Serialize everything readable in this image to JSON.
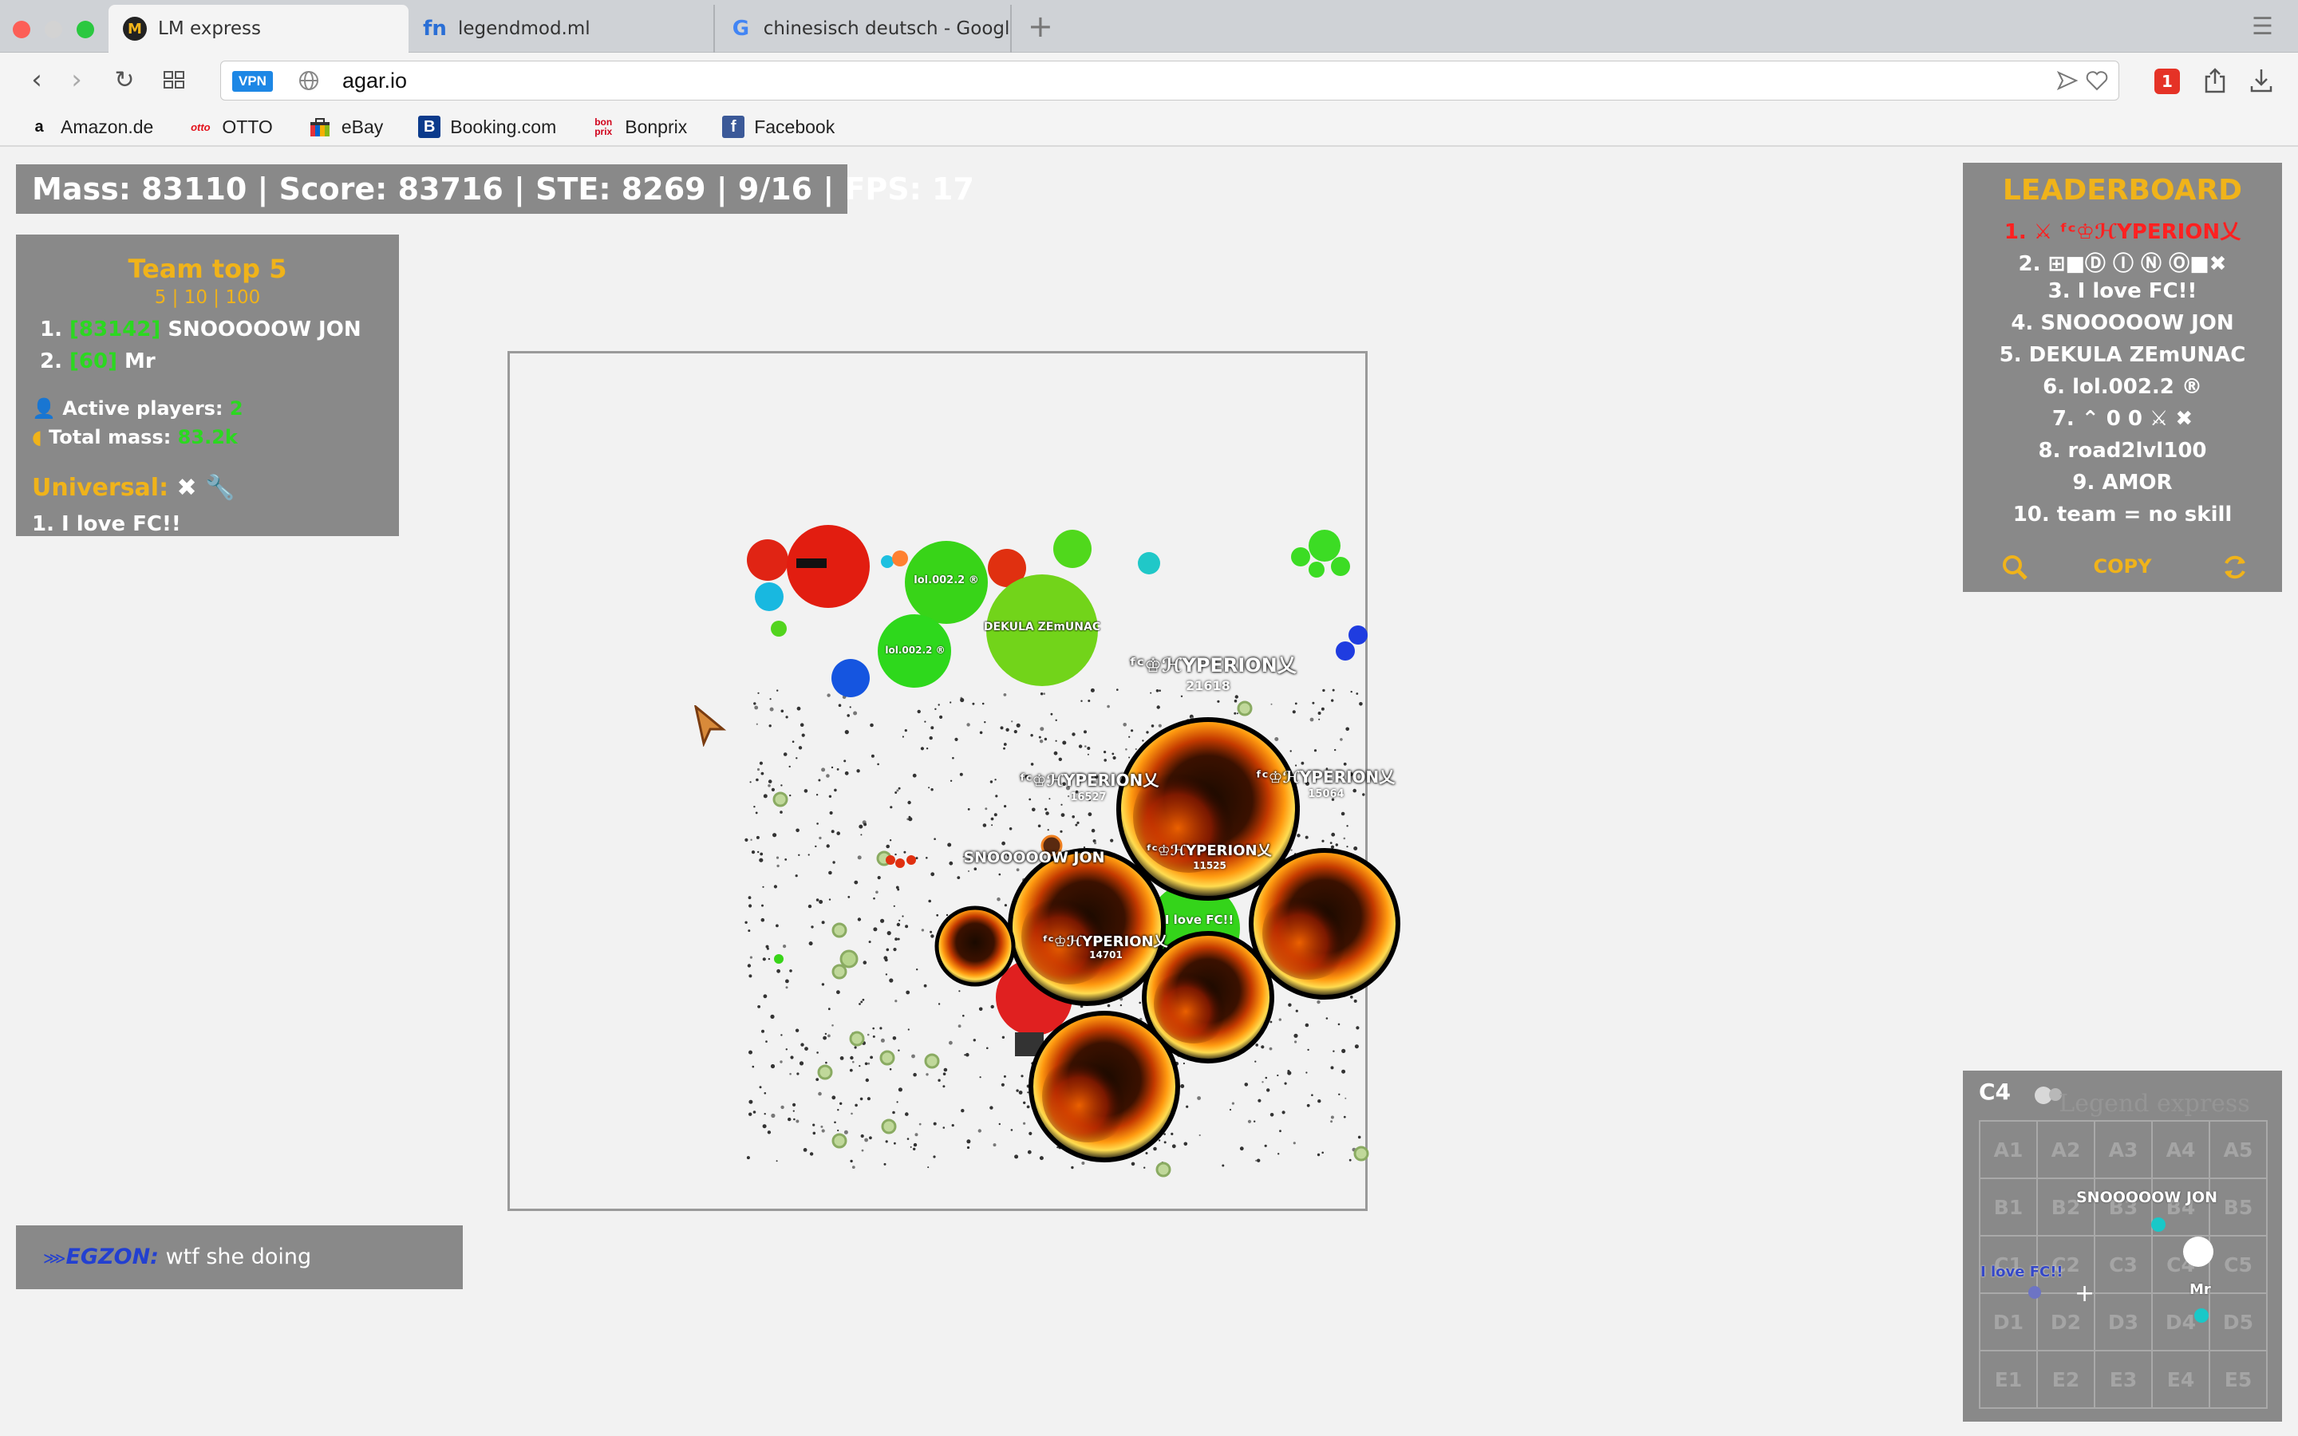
{
  "browser": {
    "tabs": [
      {
        "label": "LM express",
        "favicon": "lm-express-logo",
        "active": true
      },
      {
        "label": "legendmod.ml",
        "favicon": "legendmod-fn-logo",
        "active": false
      },
      {
        "label": "chinesisch deutsch - Google",
        "favicon": "google-g-logo",
        "active": false
      }
    ],
    "vpn_label": "VPN",
    "url": "agar.io",
    "bookmarks": [
      {
        "label": "Amazon.de",
        "icon": "amazon-a"
      },
      {
        "label": "OTTO",
        "icon": "otto-logo"
      },
      {
        "label": "eBay",
        "icon": "ebay-bag"
      },
      {
        "label": "Booking.com",
        "icon": "booking-b"
      },
      {
        "label": "Bonprix",
        "icon": "bonprix-logo"
      },
      {
        "label": "Facebook",
        "icon": "facebook-f"
      }
    ],
    "extension_badge": "1"
  },
  "hud": {
    "stats": "Mass: 83110 | Score: 83716 | STE: 8269 | 9/16 | FPS: 17",
    "team": {
      "title": "Team top 5",
      "subtitle": "5 | 10 | 100",
      "members": [
        {
          "rank": "1.",
          "tag": "[83142]",
          "name": "SNOOOOOW JON"
        },
        {
          "rank": "2.",
          "tag": "[60]",
          "name": "Mr"
        }
      ],
      "active_players_label": "Active players:",
      "active_players_value": "2",
      "total_mass_label": "Total mass:",
      "total_mass_value": "83.2k",
      "universal_label": "Universal:",
      "universal_entry": "1. I love FC!!"
    },
    "leaderboard": {
      "title": "LEADERBOARD",
      "entries": [
        "1. ⚔ ᶠᶜ♔ℋYPERION乂",
        "2. ⊞■Ⓓ Ⓘ Ⓝ Ⓞ■✖",
        "3. I love FC!!",
        "4. SNOOOOOW JON",
        "5. DEKULA ZEmUNAC",
        "6. lol.002.2 ®",
        "7. ⌃ 0 0 ⚔ ✖",
        "8. road2lvl100",
        "9. AMOR",
        "10. team = no skill"
      ],
      "highlight_color": "#ff2020",
      "copy_label": "COPY"
    },
    "chat": {
      "name": "EGZON:",
      "message": "wtf she doing"
    },
    "minimap": {
      "sector": "C4",
      "brand": "Legend express",
      "cells": [
        "A1",
        "A2",
        "A3",
        "A4",
        "A5",
        "B1",
        "B2",
        "B3",
        "B4",
        "B5",
        "C1",
        "C2",
        "C3",
        "C4",
        "C5",
        "D1",
        "D2",
        "D3",
        "D4",
        "D5",
        "E1",
        "E2",
        "E3",
        "E4",
        "E5"
      ],
      "labels": {
        "jon": "SNOOOOOW JON",
        "fc": "I love FC!!",
        "mr": "Mr"
      }
    }
  },
  "cells": {
    "hyperion_name": "ᶠᶜ♔ℋYPERION乂",
    "hyperion_masses": [
      "21618",
      "16527",
      "15064",
      "11525",
      "14701"
    ],
    "dekula_name": "DEKULA ZEmUNAC",
    "lol_name": "lol.002.2 ®",
    "jon_name": "SNOOOOOW JON",
    "fc_name": "I love FC!!"
  },
  "colors": {
    "accent": "#f0b31a",
    "team_tag": "#2bd820",
    "panel": "#808080"
  }
}
